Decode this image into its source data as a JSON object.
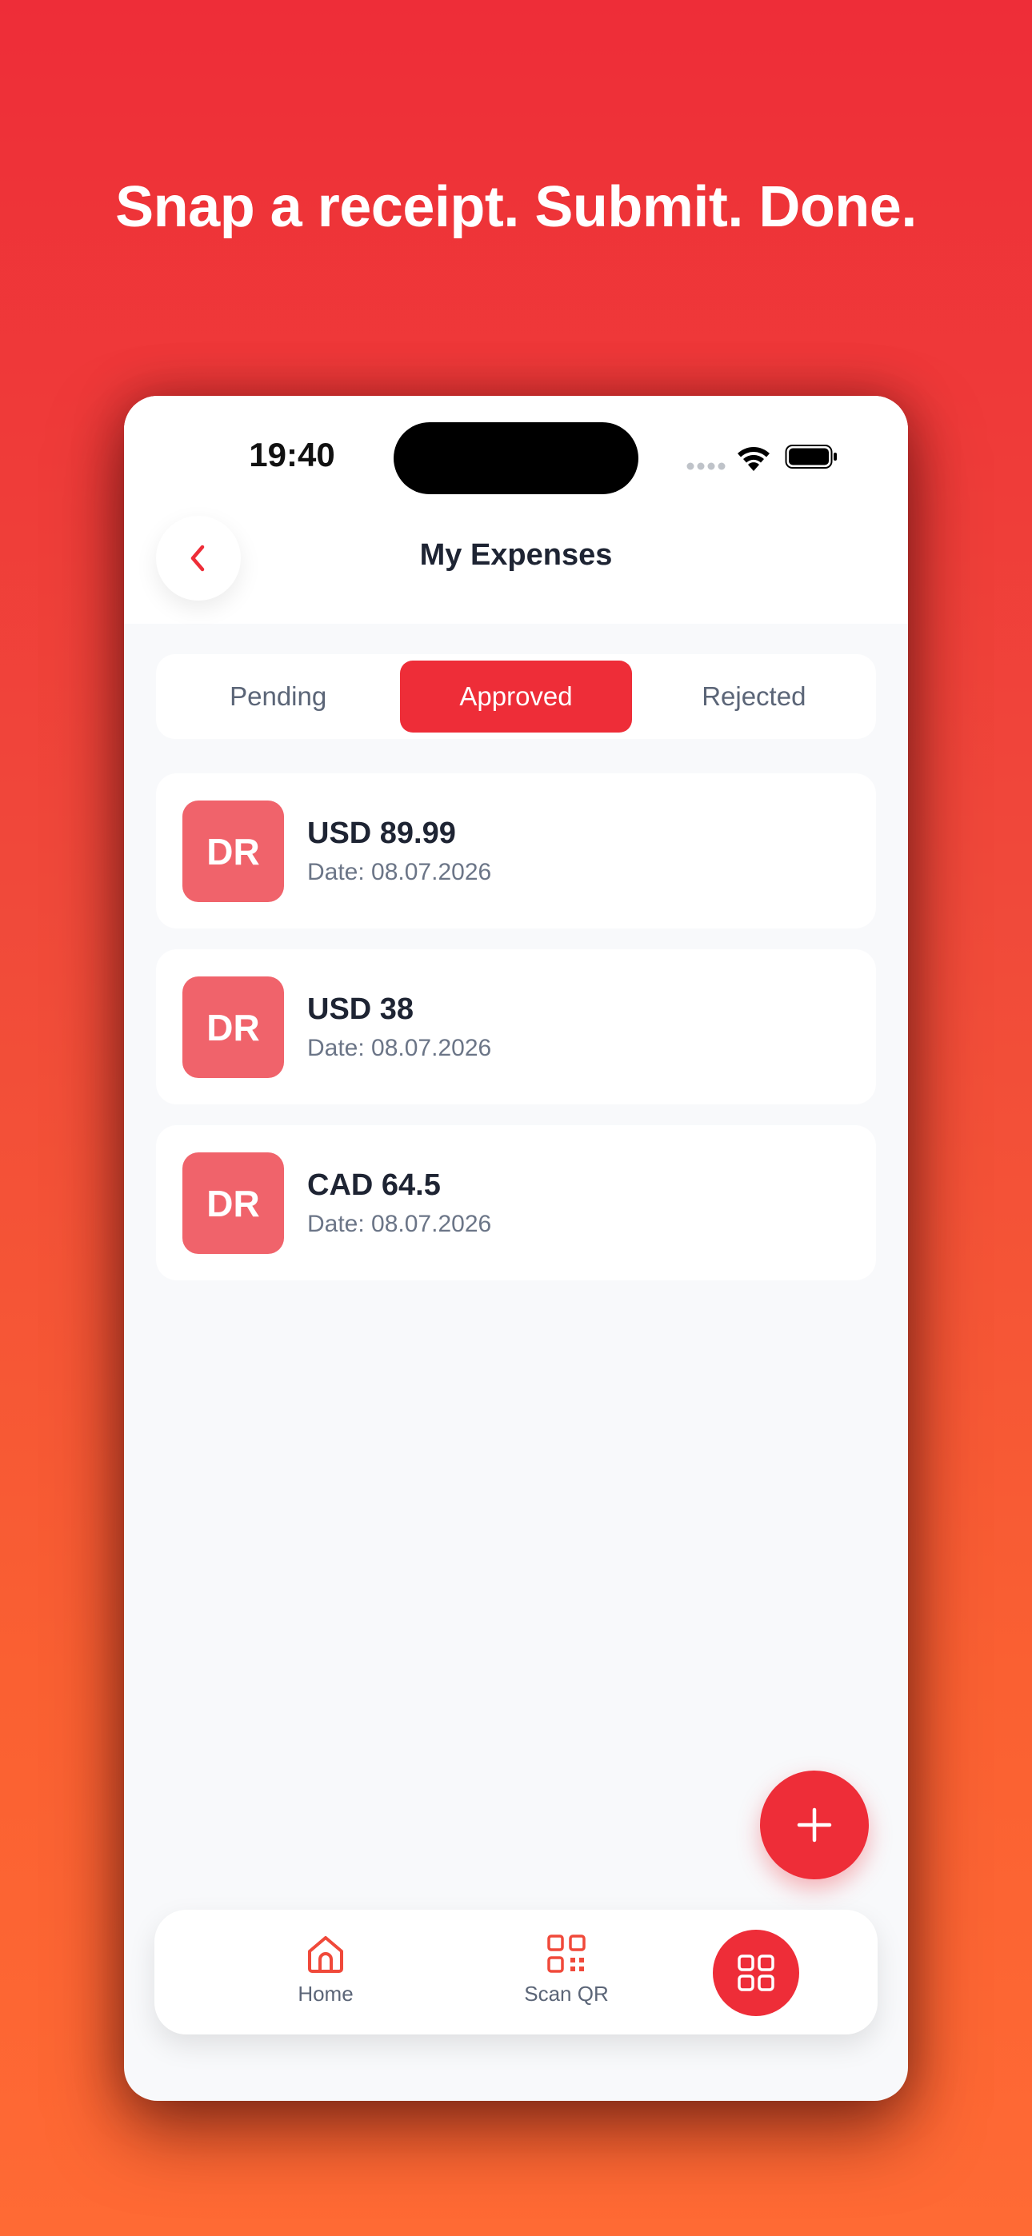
{
  "headline": "Snap a receipt. Submit. Done.",
  "status_bar": {
    "time": "19:40"
  },
  "header": {
    "title": "My Expenses",
    "back_icon": "chevron-left-icon"
  },
  "tabs": [
    {
      "label": "Pending",
      "active": false
    },
    {
      "label": "Approved",
      "active": true
    },
    {
      "label": "Rejected",
      "active": false
    }
  ],
  "expenses": [
    {
      "initials": "DR",
      "amount": "USD 89.99",
      "date": "Date: 08.07.2026"
    },
    {
      "initials": "DR",
      "amount": "USD 38",
      "date": "Date: 08.07.2026"
    },
    {
      "initials": "DR",
      "amount": "CAD 64.5",
      "date": "Date: 08.07.2026"
    }
  ],
  "fab": {
    "icon": "plus-icon"
  },
  "bottom_nav": {
    "items": [
      {
        "label": "Home",
        "icon": "home-icon"
      },
      {
        "label": "Scan QR",
        "icon": "qr-code-icon"
      }
    ],
    "menu_icon": "grid-icon"
  },
  "colors": {
    "accent": "#EE2D38",
    "avatar": "#F0636B",
    "text_primary": "#1E2433",
    "text_secondary": "#6B7587",
    "nav_icon": "#F0493A"
  }
}
